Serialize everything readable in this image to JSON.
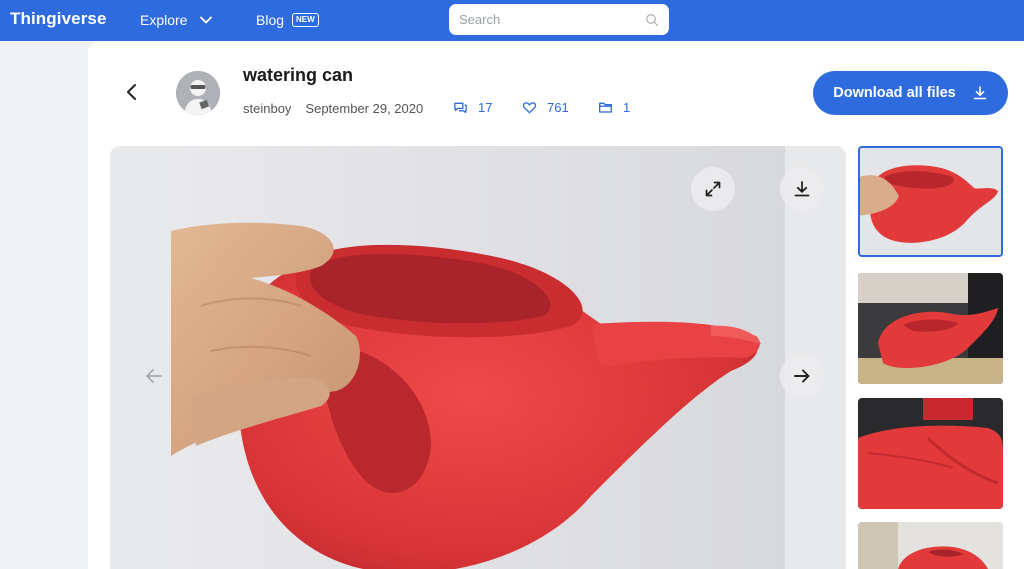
{
  "nav": {
    "logo": "Thingiverse",
    "explore": "Explore",
    "blog": "Blog",
    "blog_badge": "NEW",
    "search_placeholder": "Search"
  },
  "thing": {
    "title": "watering can",
    "author": "steinboy",
    "date": "September 29, 2020",
    "comments": "17",
    "likes": "761",
    "collections": "1"
  },
  "actions": {
    "download_all": "Download all files"
  },
  "icons": {
    "back": "chevron-left-icon",
    "explore_caret": "chevron-down-icon",
    "search": "search-icon",
    "comments": "comment-icon",
    "likes": "heart-icon",
    "collections": "folder-icon",
    "download": "download-icon",
    "expand": "expand-icon",
    "next": "arrow-right-icon",
    "prev": "arrow-left-icon"
  },
  "colors": {
    "brand": "#2e6bdf",
    "can_red": "#e23a3b"
  },
  "gallery": {
    "thumbnail_count": 4,
    "active_index": 0
  }
}
